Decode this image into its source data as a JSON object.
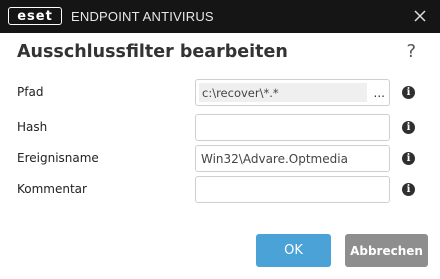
{
  "window": {
    "logo_text": "eset",
    "product_name": "ENDPOINT ANTIVIRUS",
    "close_icon": "close-icon"
  },
  "dialog": {
    "title": "Ausschlussfilter bearbeiten",
    "help_label": "?",
    "fields": [
      {
        "label": "Pfad",
        "value": "c:\\recover\\*.*",
        "browse_label": "..."
      },
      {
        "label": "Hash",
        "value": ""
      },
      {
        "label": "Ereignisname",
        "value": "Win32\\Advare.Optmedia"
      },
      {
        "label": "Kommentar",
        "value": ""
      }
    ],
    "info_glyph": "i"
  },
  "buttons": {
    "ok_label": "OK",
    "cancel_label": "Abbrechen"
  },
  "colors": {
    "titlebar": "#151515",
    "ok_button": "#4aa2d6",
    "cancel_button": "#8e8e8e"
  }
}
